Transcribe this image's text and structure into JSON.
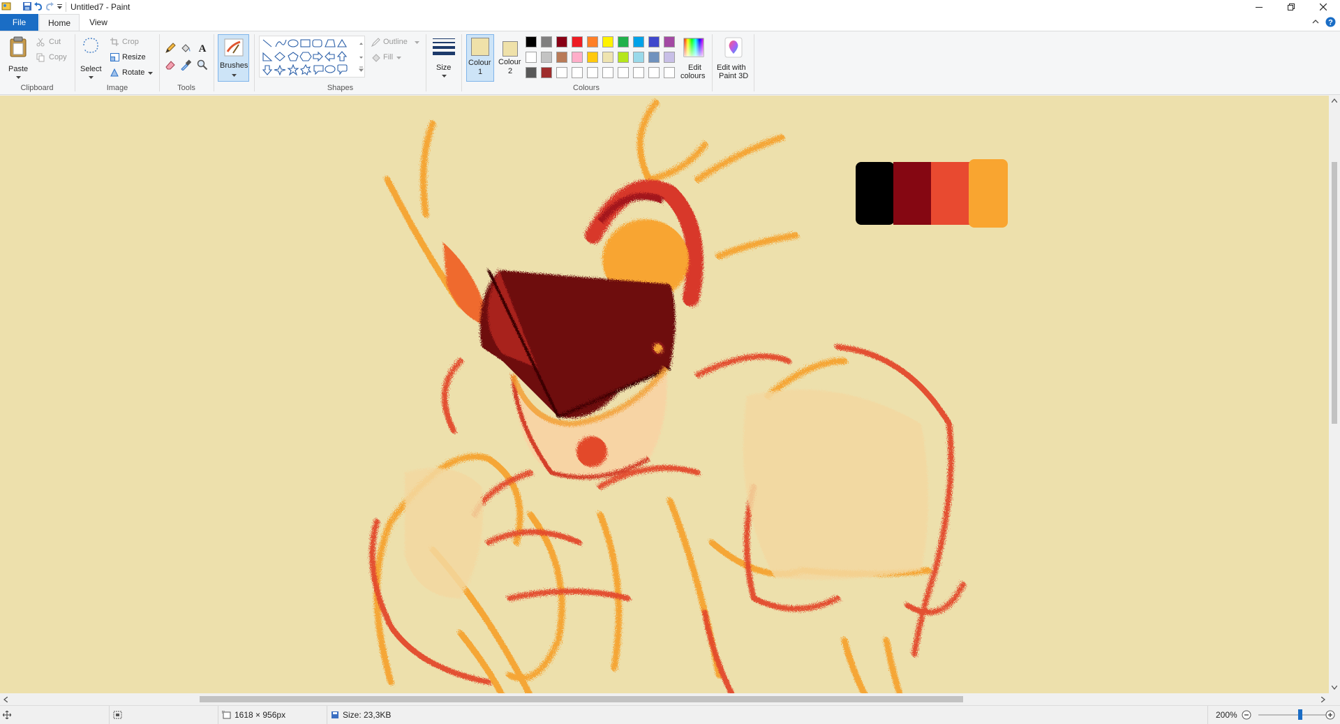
{
  "window": {
    "title": "Untitled7 - Paint"
  },
  "menu": {
    "file": "File",
    "home": "Home",
    "view": "View"
  },
  "ribbon": {
    "clipboard": {
      "group_label": "Clipboard",
      "paste": "Paste",
      "cut": "Cut",
      "copy": "Copy"
    },
    "image": {
      "group_label": "Image",
      "select": "Select",
      "crop": "Crop",
      "resize": "Resize",
      "rotate": "Rotate"
    },
    "tools": {
      "group_label": "Tools"
    },
    "brushes": {
      "label": "Brushes"
    },
    "shapes": {
      "group_label": "Shapes",
      "outline": "Outline",
      "fill": "Fill"
    },
    "size": {
      "label": "Size"
    },
    "colours": {
      "group_label": "Colours",
      "colour1_line1": "Colour",
      "colour1_line2": "1",
      "colour2_line1": "Colour",
      "colour2_line2": "2",
      "colour1_value": "#efe1a9",
      "colour2_value": "#efe1a9",
      "edit_line1": "Edit",
      "edit_line2": "colours",
      "palette": [
        "#000000",
        "#7f7f7f",
        "#880015",
        "#ed1c24",
        "#ff7f27",
        "#fff200",
        "#22b14c",
        "#00a2e8",
        "#3f48cc",
        "#a349a4",
        "#ffffff",
        "#c3c3c3",
        "#b97a57",
        "#ffaec9",
        "#ffc90e",
        "#efe4b0",
        "#b5e61d",
        "#99d9ea",
        "#7092be",
        "#c8bfe7",
        "#585858",
        "#9f2d2d",
        "#ffffff",
        "#ffffff",
        "#ffffff",
        "#ffffff",
        "#ffffff",
        "#ffffff",
        "#ffffff",
        "#ffffff"
      ]
    },
    "paint3d": {
      "line1": "Edit with",
      "line2": "Paint 3D"
    }
  },
  "canvas": {
    "background": "#ede0ac",
    "swatches": [
      "#000000",
      "#850712",
      "#e84a30",
      "#f9a530"
    ]
  },
  "status": {
    "dimensions": "1618 × 956px",
    "size": "Size: 23,3KB",
    "zoom": "200%",
    "zoom_fraction": 0.6
  }
}
